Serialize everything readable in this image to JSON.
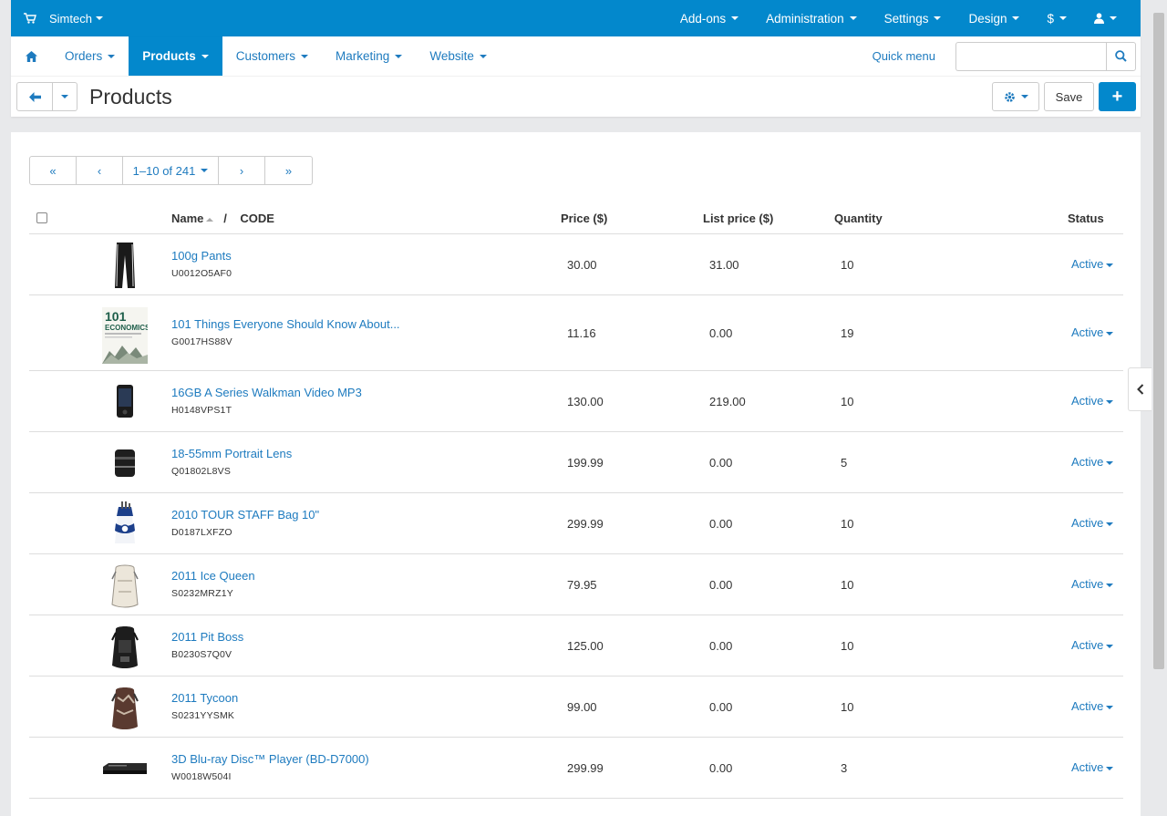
{
  "topbar": {
    "brand": "Simtech",
    "menus": [
      "Add-ons",
      "Administration",
      "Settings",
      "Design",
      "$"
    ]
  },
  "nav": {
    "tabs": [
      {
        "label": "Orders",
        "active": false
      },
      {
        "label": "Products",
        "active": true
      },
      {
        "label": "Customers",
        "active": false
      },
      {
        "label": "Marketing",
        "active": false
      },
      {
        "label": "Website",
        "active": false
      }
    ],
    "quick_menu": "Quick menu",
    "search_value": ""
  },
  "title": "Products",
  "toolbar": {
    "save_label": "Save",
    "add_label": "+"
  },
  "pager": {
    "first": "«",
    "prev": "‹",
    "range": "1–10 of 241",
    "next": "›",
    "last": "»"
  },
  "table": {
    "headers": {
      "name": "Name",
      "sep": "/",
      "code": "CODE",
      "price": "Price ($)",
      "list_price": "List price ($)",
      "quantity": "Quantity",
      "status": "Status"
    },
    "rows": [
      {
        "name": "100g Pants",
        "code": "U0012O5AF0",
        "price": "30.00",
        "list_price": "31.00",
        "qty": "10",
        "status": "Active",
        "icon": "pants-icon"
      },
      {
        "name": "101 Things Everyone Should Know About...",
        "code": "G0017HS88V",
        "price": "11.16",
        "list_price": "0.00",
        "qty": "19",
        "status": "Active",
        "icon": "book-icon"
      },
      {
        "name": "16GB A Series Walkman Video MP3",
        "code": "H0148VPS1T",
        "price": "130.00",
        "list_price": "219.00",
        "qty": "10",
        "status": "Active",
        "icon": "mp3-player-icon"
      },
      {
        "name": "18-55mm Portrait Lens",
        "code": "Q01802L8VS",
        "price": "199.99",
        "list_price": "0.00",
        "qty": "5",
        "status": "Active",
        "icon": "lens-icon"
      },
      {
        "name": "2010 TOUR STAFF Bag 10\"",
        "code": "D0187LXFZO",
        "price": "299.99",
        "list_price": "0.00",
        "qty": "10",
        "status": "Active",
        "icon": "golf-bag-icon"
      },
      {
        "name": "2011 Ice Queen",
        "code": "S0232MRZ1Y",
        "price": "79.95",
        "list_price": "0.00",
        "qty": "10",
        "status": "Active",
        "icon": "backpack-light-icon"
      },
      {
        "name": "2011 Pit Boss",
        "code": "B0230S7Q0V",
        "price": "125.00",
        "list_price": "0.00",
        "qty": "10",
        "status": "Active",
        "icon": "backpack-dark-icon"
      },
      {
        "name": "2011 Tycoon",
        "code": "S0231YYSMK",
        "price": "99.00",
        "list_price": "0.00",
        "qty": "10",
        "status": "Active",
        "icon": "backpack-brown-icon"
      },
      {
        "name": "3D Blu-ray Disc™ Player (BD-D7000)",
        "code": "W0018W504I",
        "price": "299.99",
        "list_price": "0.00",
        "qty": "3",
        "status": "Active",
        "icon": "bluray-player-icon"
      }
    ]
  },
  "book_cover": {
    "number": "101",
    "word": "ECONOMICS"
  },
  "colors": {
    "primary": "#0388cc",
    "link": "#1e7bbf"
  }
}
